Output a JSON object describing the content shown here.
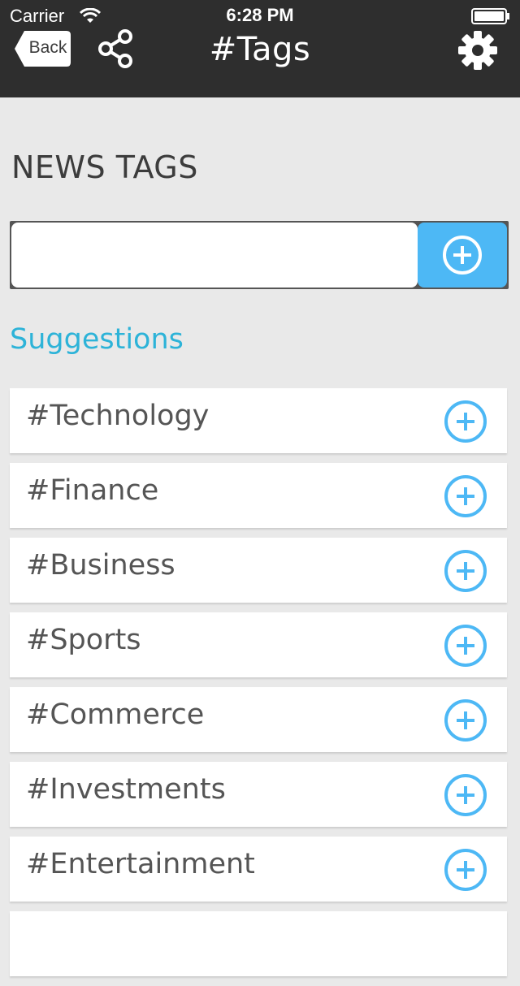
{
  "status_bar": {
    "carrier": "Carrier",
    "time": "6:28 PM"
  },
  "header": {
    "back_label": "Back",
    "title": "#Tags",
    "background": "#2e2e2e",
    "icons": [
      "back-icon",
      "share-icon",
      "gear-icon"
    ]
  },
  "main": {
    "heading": "NEWS TAGS",
    "tag_input": {
      "value": "",
      "placeholder": ""
    },
    "add_button_icon": "plus-circle-icon",
    "suggestions_label": "Suggestions",
    "suggestions": [
      {
        "label": "#Technology"
      },
      {
        "label": "#Finance"
      },
      {
        "label": "#Business"
      },
      {
        "label": "#Sports"
      },
      {
        "label": "#Commerce"
      },
      {
        "label": "#Investments"
      },
      {
        "label": "#Entertainment"
      }
    ]
  },
  "colors": {
    "accent": "#4db8f5",
    "suggestions_text": "#2db3d8",
    "background": "#e9e9e9"
  }
}
